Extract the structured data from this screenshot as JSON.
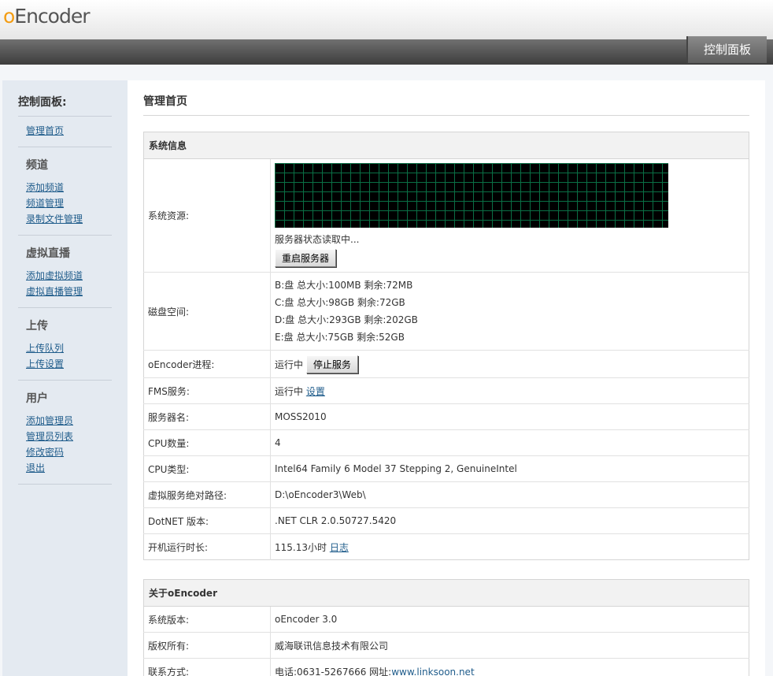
{
  "header": {
    "logo_o": "o",
    "logo_rest": "Encoder",
    "tab_label": "控制面板"
  },
  "sidebar": {
    "title": "控制面板:",
    "home": "管理首页",
    "groups": [
      {
        "title": "频道",
        "items": [
          "添加频道",
          "频道管理",
          "录制文件管理"
        ]
      },
      {
        "title": "虚拟直播",
        "items": [
          "添加虚拟频道",
          "虚拟直播管理"
        ]
      },
      {
        "title": "上传",
        "items": [
          "上传队列",
          "上传设置"
        ]
      },
      {
        "title": "用户",
        "items": [
          "添加管理员",
          "管理员列表",
          "修改密码",
          "退出"
        ]
      }
    ]
  },
  "main": {
    "title": "管理首页",
    "system": {
      "heading": "系统信息",
      "resources_label": "系统资源:",
      "status_text": "服务器状态读取中...",
      "restart_button": "重启服务器",
      "disk_label": "磁盘空间:",
      "disks": [
        "B:盘  总大小:100MB  剩余:72MB",
        "C:盘  总大小:98GB  剩余:72GB",
        "D:盘  总大小:293GB  剩余:202GB",
        "E:盘  总大小:75GB  剩余:52GB"
      ],
      "process_label": "oEncoder进程:",
      "process_status": "运行中",
      "stop_button": "停止服务",
      "fms_label": "FMS服务:",
      "fms_status": "运行中",
      "fms_link": "设置",
      "server_name_label": "服务器名:",
      "server_name": "MOSS2010",
      "cpu_count_label": "CPU数量:",
      "cpu_count": "4",
      "cpu_type_label": "CPU类型:",
      "cpu_type": "Intel64 Family 6 Model 37 Stepping 2, GenuineIntel",
      "vpath_label": "虚拟服务绝对路径:",
      "vpath": "D:\\oEncoder3\\Web\\",
      "dotnet_label": "DotNET 版本:",
      "dotnet": ".NET CLR 2.0.50727.5420",
      "uptime_label": "开机运行时长:",
      "uptime": "115.13小时",
      "log_link": "日志"
    },
    "about": {
      "heading": "关于oEncoder",
      "version_label": "系统版本:",
      "version": "oEncoder 3.0",
      "copyright_label": "版权所有:",
      "copyright": "威海联讯信息技术有限公司",
      "contact_label": "联系方式:",
      "contact": "电话:0631-5267666 网址:",
      "website": "www.linksoon.net"
    }
  }
}
